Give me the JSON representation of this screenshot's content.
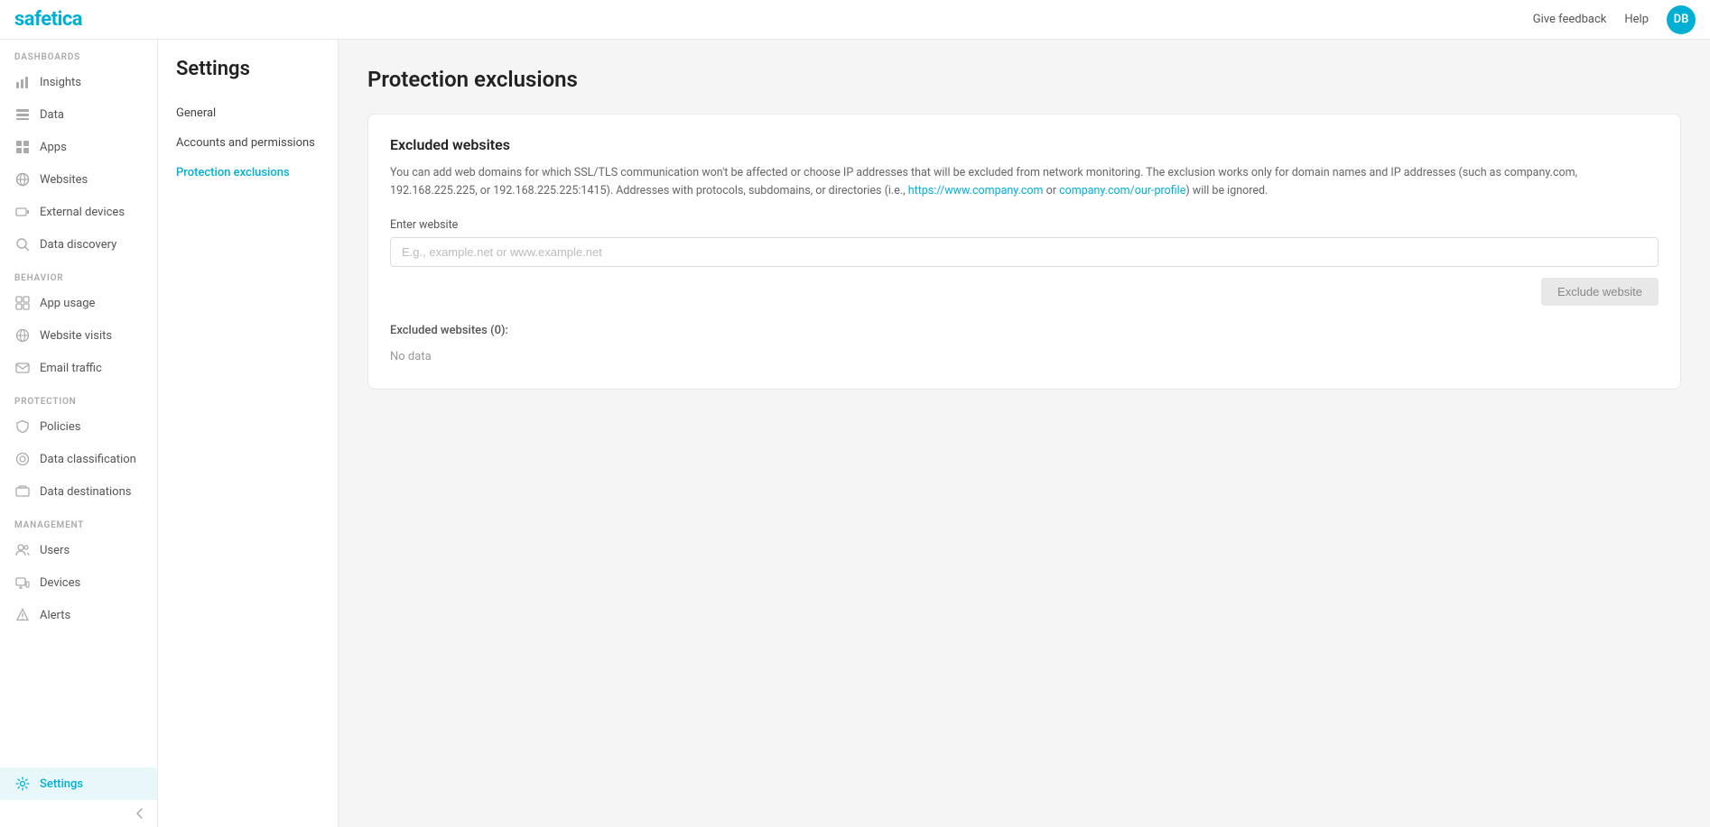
{
  "topbar": {
    "logo_text": "safetica",
    "feedback_label": "Give feedback",
    "help_label": "Help",
    "avatar_initials": "DB"
  },
  "sidebar": {
    "dashboards_label": "DASHBOARDS",
    "behavior_label": "BEHAVIOR",
    "protection_label": "PROTECTION",
    "management_label": "MANAGEMENT",
    "items": [
      {
        "id": "insights",
        "label": "Insights",
        "icon": "insights"
      },
      {
        "id": "data",
        "label": "Data",
        "icon": "data"
      },
      {
        "id": "apps",
        "label": "Apps",
        "icon": "apps"
      },
      {
        "id": "websites",
        "label": "Websites",
        "icon": "websites"
      },
      {
        "id": "external-devices",
        "label": "External devices",
        "icon": "external-devices"
      },
      {
        "id": "data-discovery",
        "label": "Data discovery",
        "icon": "data-discovery"
      },
      {
        "id": "app-usage",
        "label": "App usage",
        "icon": "app-usage"
      },
      {
        "id": "website-visits",
        "label": "Website visits",
        "icon": "website-visits"
      },
      {
        "id": "email-traffic",
        "label": "Email traffic",
        "icon": "email-traffic"
      },
      {
        "id": "policies",
        "label": "Policies",
        "icon": "policies"
      },
      {
        "id": "data-classification",
        "label": "Data classification",
        "icon": "data-classification"
      },
      {
        "id": "data-destinations",
        "label": "Data destinations",
        "icon": "data-destinations"
      },
      {
        "id": "users",
        "label": "Users",
        "icon": "users"
      },
      {
        "id": "devices",
        "label": "Devices",
        "icon": "devices"
      },
      {
        "id": "alerts",
        "label": "Alerts",
        "icon": "alerts"
      },
      {
        "id": "settings",
        "label": "Settings",
        "icon": "settings"
      }
    ]
  },
  "settings": {
    "title": "Settings",
    "nav_items": [
      {
        "id": "general",
        "label": "General"
      },
      {
        "id": "accounts-permissions",
        "label": "Accounts and permissions"
      },
      {
        "id": "protection-exclusions",
        "label": "Protection exclusions"
      }
    ]
  },
  "page": {
    "title": "Protection exclusions",
    "card": {
      "section_title": "Excluded websites",
      "description_main": "You can add web domains for which SSL/TLS communication won't be affected or choose IP addresses that will be excluded from network monitoring. The exclusion works only for domain names and IP addresses (such as company.com, 192.168.225.225, or 192.168.225.225:1415). Addresses with protocols, subdomains, or directories (i.e., https://www.company.com or company.com/our-profile) will be ignored.",
      "field_label": "Enter website",
      "field_placeholder": "E.g., example.net or www.example.net",
      "exclude_button": "Exclude website",
      "excluded_count_label": "Excluded websites (0):",
      "no_data_label": "No data"
    }
  }
}
